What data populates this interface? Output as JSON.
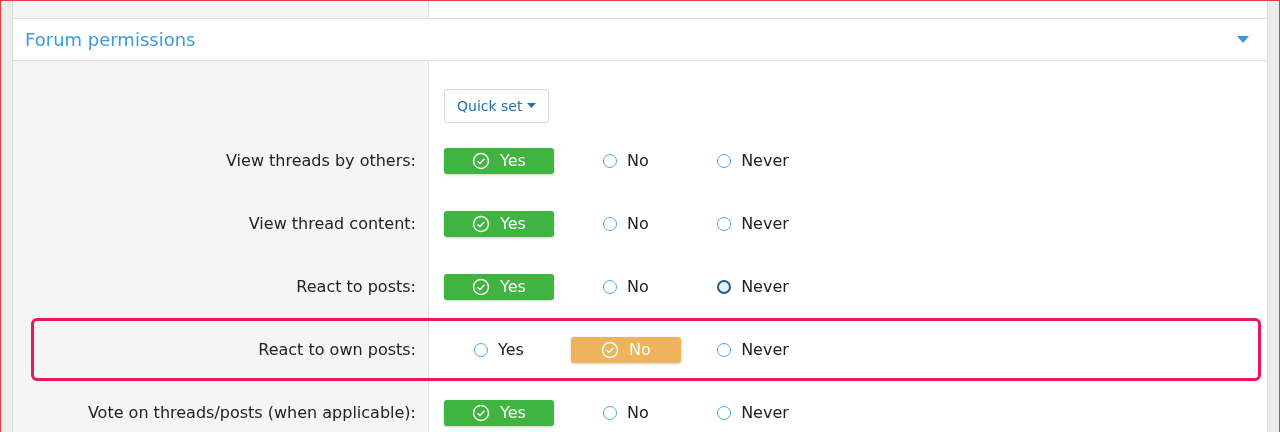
{
  "section": {
    "title": "Forum permissions",
    "expanded": true
  },
  "quick_set": {
    "label": "Quick set"
  },
  "permissions": [
    {
      "label": "View threads by others:",
      "highlighted": false,
      "options": [
        {
          "label": "Yes",
          "selected": true
        },
        {
          "label": "No",
          "selected": false
        },
        {
          "label": "Never",
          "selected": false
        }
      ]
    },
    {
      "label": "View thread content:",
      "highlighted": false,
      "options": [
        {
          "label": "Yes",
          "selected": true
        },
        {
          "label": "No",
          "selected": false
        },
        {
          "label": "Never",
          "selected": false
        }
      ]
    },
    {
      "label": "React to posts:",
      "highlighted": false,
      "options": [
        {
          "label": "Yes",
          "selected": true
        },
        {
          "label": "No",
          "selected": false
        },
        {
          "label": "Never",
          "selected": false,
          "focused": true
        }
      ]
    },
    {
      "label": "React to own posts:",
      "highlighted": true,
      "options": [
        {
          "label": "Yes",
          "selected": false
        },
        {
          "label": "No",
          "selected": true
        },
        {
          "label": "Never",
          "selected": false
        }
      ]
    },
    {
      "label": "Vote on threads/posts (when applicable):",
      "highlighted": false,
      "options": [
        {
          "label": "Yes",
          "selected": true
        },
        {
          "label": "No",
          "selected": false
        },
        {
          "label": "Never",
          "selected": false
        }
      ]
    }
  ]
}
